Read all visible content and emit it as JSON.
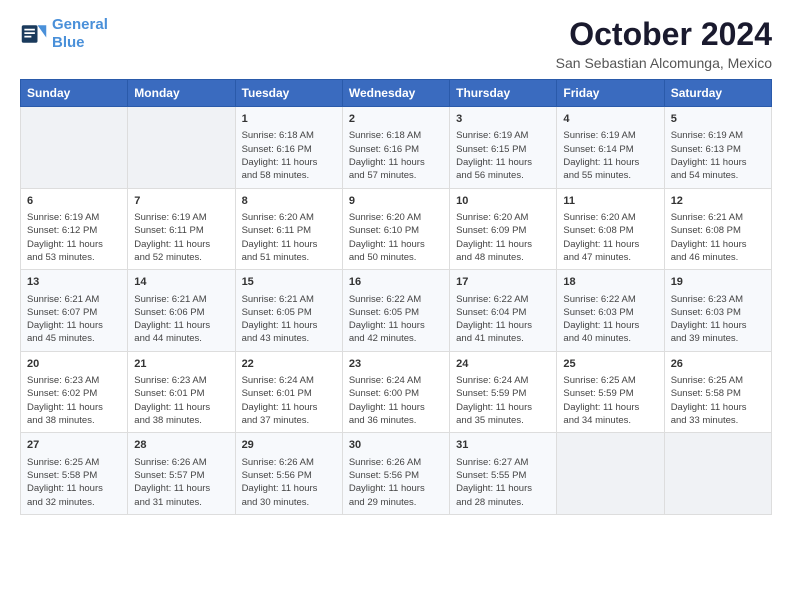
{
  "header": {
    "logo_line1": "General",
    "logo_line2": "Blue",
    "month": "October 2024",
    "location": "San Sebastian Alcomunga, Mexico"
  },
  "weekdays": [
    "Sunday",
    "Monday",
    "Tuesday",
    "Wednesday",
    "Thursday",
    "Friday",
    "Saturday"
  ],
  "weeks": [
    [
      {
        "day": "",
        "info": ""
      },
      {
        "day": "",
        "info": ""
      },
      {
        "day": "1",
        "info": "Sunrise: 6:18 AM\nSunset: 6:16 PM\nDaylight: 11 hours and 58 minutes."
      },
      {
        "day": "2",
        "info": "Sunrise: 6:18 AM\nSunset: 6:16 PM\nDaylight: 11 hours and 57 minutes."
      },
      {
        "day": "3",
        "info": "Sunrise: 6:19 AM\nSunset: 6:15 PM\nDaylight: 11 hours and 56 minutes."
      },
      {
        "day": "4",
        "info": "Sunrise: 6:19 AM\nSunset: 6:14 PM\nDaylight: 11 hours and 55 minutes."
      },
      {
        "day": "5",
        "info": "Sunrise: 6:19 AM\nSunset: 6:13 PM\nDaylight: 11 hours and 54 minutes."
      }
    ],
    [
      {
        "day": "6",
        "info": "Sunrise: 6:19 AM\nSunset: 6:12 PM\nDaylight: 11 hours and 53 minutes."
      },
      {
        "day": "7",
        "info": "Sunrise: 6:19 AM\nSunset: 6:11 PM\nDaylight: 11 hours and 52 minutes."
      },
      {
        "day": "8",
        "info": "Sunrise: 6:20 AM\nSunset: 6:11 PM\nDaylight: 11 hours and 51 minutes."
      },
      {
        "day": "9",
        "info": "Sunrise: 6:20 AM\nSunset: 6:10 PM\nDaylight: 11 hours and 50 minutes."
      },
      {
        "day": "10",
        "info": "Sunrise: 6:20 AM\nSunset: 6:09 PM\nDaylight: 11 hours and 48 minutes."
      },
      {
        "day": "11",
        "info": "Sunrise: 6:20 AM\nSunset: 6:08 PM\nDaylight: 11 hours and 47 minutes."
      },
      {
        "day": "12",
        "info": "Sunrise: 6:21 AM\nSunset: 6:08 PM\nDaylight: 11 hours and 46 minutes."
      }
    ],
    [
      {
        "day": "13",
        "info": "Sunrise: 6:21 AM\nSunset: 6:07 PM\nDaylight: 11 hours and 45 minutes."
      },
      {
        "day": "14",
        "info": "Sunrise: 6:21 AM\nSunset: 6:06 PM\nDaylight: 11 hours and 44 minutes."
      },
      {
        "day": "15",
        "info": "Sunrise: 6:21 AM\nSunset: 6:05 PM\nDaylight: 11 hours and 43 minutes."
      },
      {
        "day": "16",
        "info": "Sunrise: 6:22 AM\nSunset: 6:05 PM\nDaylight: 11 hours and 42 minutes."
      },
      {
        "day": "17",
        "info": "Sunrise: 6:22 AM\nSunset: 6:04 PM\nDaylight: 11 hours and 41 minutes."
      },
      {
        "day": "18",
        "info": "Sunrise: 6:22 AM\nSunset: 6:03 PM\nDaylight: 11 hours and 40 minutes."
      },
      {
        "day": "19",
        "info": "Sunrise: 6:23 AM\nSunset: 6:03 PM\nDaylight: 11 hours and 39 minutes."
      }
    ],
    [
      {
        "day": "20",
        "info": "Sunrise: 6:23 AM\nSunset: 6:02 PM\nDaylight: 11 hours and 38 minutes."
      },
      {
        "day": "21",
        "info": "Sunrise: 6:23 AM\nSunset: 6:01 PM\nDaylight: 11 hours and 38 minutes."
      },
      {
        "day": "22",
        "info": "Sunrise: 6:24 AM\nSunset: 6:01 PM\nDaylight: 11 hours and 37 minutes."
      },
      {
        "day": "23",
        "info": "Sunrise: 6:24 AM\nSunset: 6:00 PM\nDaylight: 11 hours and 36 minutes."
      },
      {
        "day": "24",
        "info": "Sunrise: 6:24 AM\nSunset: 5:59 PM\nDaylight: 11 hours and 35 minutes."
      },
      {
        "day": "25",
        "info": "Sunrise: 6:25 AM\nSunset: 5:59 PM\nDaylight: 11 hours and 34 minutes."
      },
      {
        "day": "26",
        "info": "Sunrise: 6:25 AM\nSunset: 5:58 PM\nDaylight: 11 hours and 33 minutes."
      }
    ],
    [
      {
        "day": "27",
        "info": "Sunrise: 6:25 AM\nSunset: 5:58 PM\nDaylight: 11 hours and 32 minutes."
      },
      {
        "day": "28",
        "info": "Sunrise: 6:26 AM\nSunset: 5:57 PM\nDaylight: 11 hours and 31 minutes."
      },
      {
        "day": "29",
        "info": "Sunrise: 6:26 AM\nSunset: 5:56 PM\nDaylight: 11 hours and 30 minutes."
      },
      {
        "day": "30",
        "info": "Sunrise: 6:26 AM\nSunset: 5:56 PM\nDaylight: 11 hours and 29 minutes."
      },
      {
        "day": "31",
        "info": "Sunrise: 6:27 AM\nSunset: 5:55 PM\nDaylight: 11 hours and 28 minutes."
      },
      {
        "day": "",
        "info": ""
      },
      {
        "day": "",
        "info": ""
      }
    ]
  ]
}
